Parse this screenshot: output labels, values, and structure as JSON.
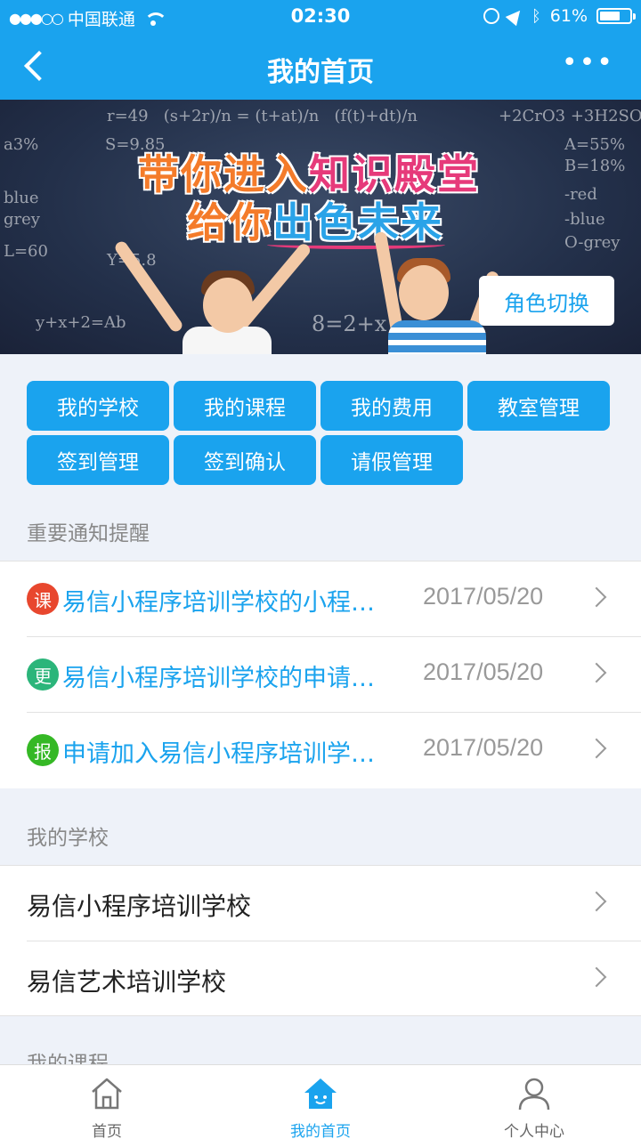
{
  "status_bar": {
    "carrier": "中国联通",
    "time": "02:30",
    "battery": "61%"
  },
  "nav": {
    "title": "我的首页",
    "more": "•••"
  },
  "banner": {
    "slogan_line1_a": "带你进入",
    "slogan_line1_b": "知识殿堂",
    "slogan_line2_a": "给你",
    "slogan_line2_b": "出色未来",
    "role_switch": "角色切换"
  },
  "menu": [
    {
      "label": "我的学校"
    },
    {
      "label": "我的课程"
    },
    {
      "label": "我的费用"
    },
    {
      "label": "教室管理"
    },
    {
      "label": "签到管理"
    },
    {
      "label": "签到确认"
    },
    {
      "label": "请假管理"
    }
  ],
  "notices_section": {
    "title": "重要通知提醒",
    "items": [
      {
        "badge": "课",
        "badge_color": "#e8472e",
        "text": "易信小程序培训学校的小程…",
        "date": "2017/05/20"
      },
      {
        "badge": "更",
        "badge_color": "#2bb57a",
        "text": "易信小程序培训学校的申请…",
        "date": "2017/05/20"
      },
      {
        "badge": "报",
        "badge_color": "#35b825",
        "text": "申请加入易信小程序培训学…",
        "date": "2017/05/20"
      }
    ]
  },
  "schools_section": {
    "title": "我的学校",
    "items": [
      {
        "name": "易信小程序培训学校"
      },
      {
        "name": "易信艺术培训学校"
      }
    ]
  },
  "courses_section": {
    "title": "我的课程"
  },
  "tabbar": {
    "tabs": [
      {
        "label": "首页"
      },
      {
        "label": "我的首页"
      },
      {
        "label": "个人中心"
      }
    ]
  },
  "colors": {
    "primary": "#1aa3ee",
    "background": "#eef2f9"
  }
}
